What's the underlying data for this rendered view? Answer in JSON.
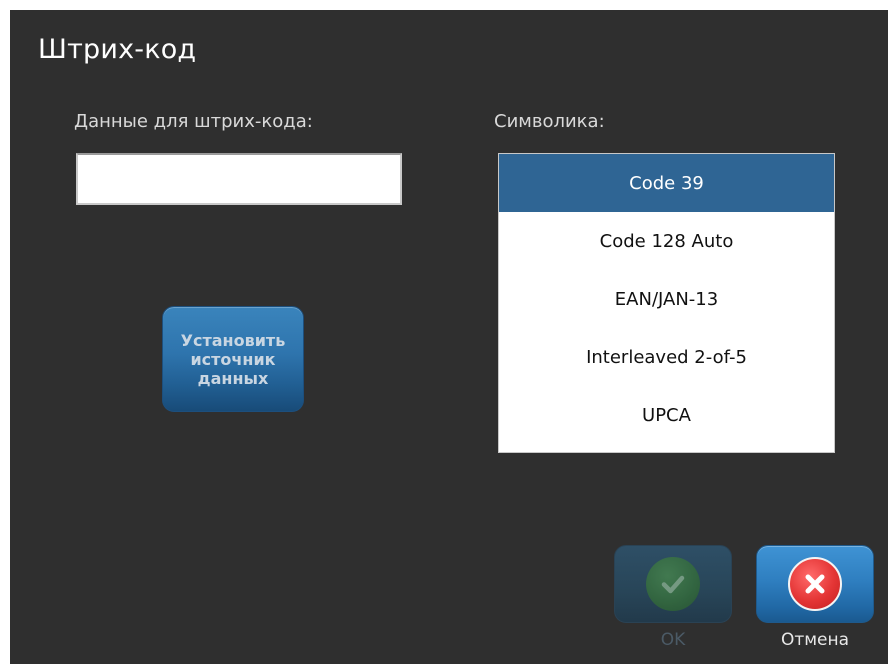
{
  "dialog": {
    "title": "Штрих-код"
  },
  "barcode_data": {
    "label": "Данные для штрих-кода:",
    "value": "",
    "set_source_label": "Установить\nисточник\nданных"
  },
  "symbology": {
    "label": "Символика:",
    "selected": "Code 39",
    "options": [
      {
        "label": "Code 39"
      },
      {
        "label": "Code 128 Auto"
      },
      {
        "label": "EAN/JAN-13"
      },
      {
        "label": "Interleaved 2-of-5"
      },
      {
        "label": "UPCA"
      }
    ]
  },
  "actions": {
    "ok_label": "OK",
    "ok_enabled": false,
    "cancel_label": "Отмена"
  },
  "colors": {
    "background": "#2f2f2f",
    "selection": "#2f6594",
    "button_blue": "#2f7fc0",
    "cancel_red": "#e43535",
    "ok_green": "#356f38"
  },
  "icons": {
    "ok": "checkmark-icon",
    "cancel": "close-x-icon"
  }
}
